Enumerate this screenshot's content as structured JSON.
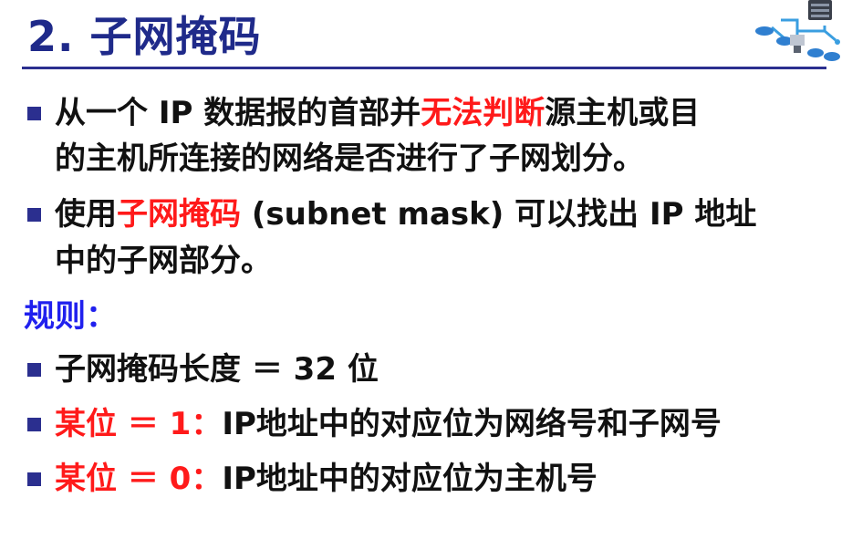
{
  "title": "2. 子网掩码",
  "bullet1": {
    "part1": "从一个 IP 数据报的首部并",
    "highlight": "无法判断",
    "part2": "源主机或目",
    "line2": "的主机所连接的网络是否进行了子网划分。"
  },
  "bullet2": {
    "part1": "使用",
    "highlight": "子网掩码",
    "part2": " (subnet mask) 可以找出 IP 地址",
    "line2": "中的子网部分。"
  },
  "rules_heading": "规则：",
  "rule1": "子网掩码长度 ＝ 32 位",
  "rule2": {
    "highlight": "某位 ＝ 1：",
    "text": "IP地址中的对应位为网络号和子网号"
  },
  "rule3": {
    "highlight": "某位 ＝ 0：",
    "text": "IP地址中的对应位为主机号"
  },
  "colors": {
    "title": "#1f2a8a",
    "bullet": "#2b2f8f",
    "emphasis": "#ff1a1a",
    "heading": "#2020ee"
  },
  "icons": [
    "network-diagram-icon"
  ]
}
